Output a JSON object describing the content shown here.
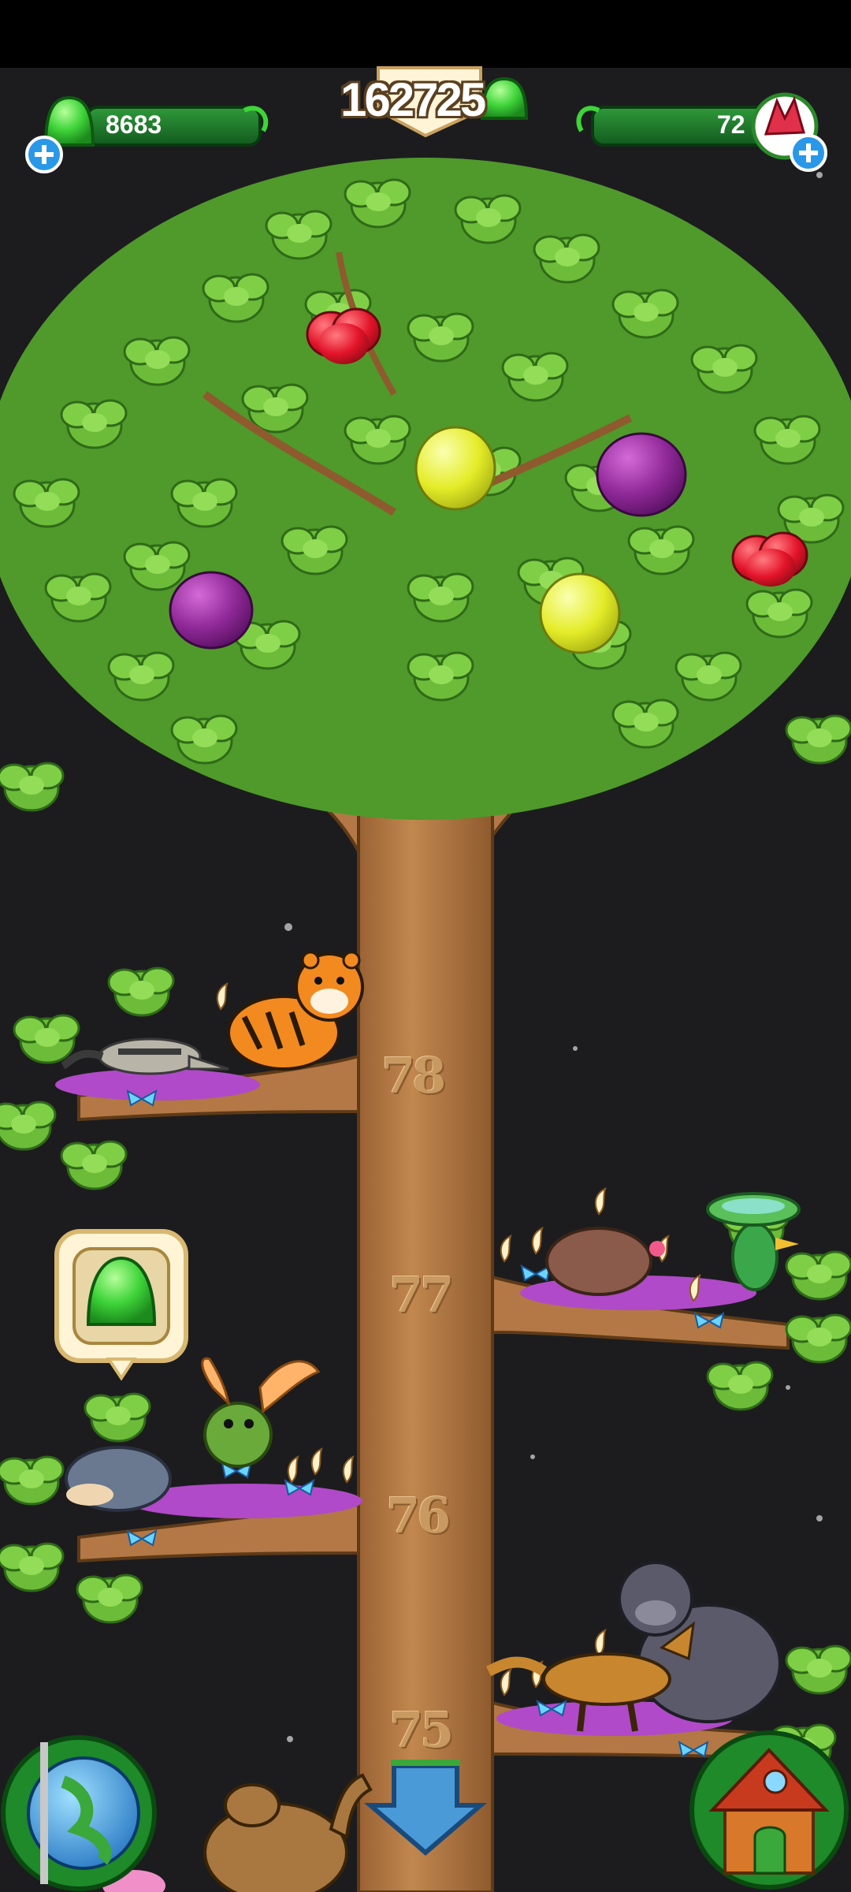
{
  "hud": {
    "gems": "8683",
    "total_score": "162725",
    "crystals": "72"
  },
  "tree": {
    "levels": [
      {
        "level": "78",
        "animals": [
          "anteater",
          "tiger"
        ]
      },
      {
        "level": "77",
        "animals": [
          "mole",
          "plant-bird"
        ]
      },
      {
        "level": "76",
        "animals": [
          "hedgehog",
          "winged-frog"
        ]
      },
      {
        "level": "75",
        "animals": [
          "jackal",
          "gorilla"
        ]
      }
    ],
    "fruits": [
      "red-fruit",
      "yellow-fruit",
      "purple-fruit",
      "purple-fruit",
      "yellow-fruit",
      "red-fruit"
    ]
  },
  "colors": {
    "background": "#0a0a0a",
    "sky": "#1c1c1e",
    "trunk": "#b37845",
    "leaf": "#6cbc3a",
    "gem_green": "#3fd43a",
    "crystal_red": "#e0304a"
  },
  "buttons": {
    "world": "globe-icon",
    "scroll_down": "arrow-down-icon",
    "home": "house-icon",
    "collect_gem": "gem-bubble"
  }
}
